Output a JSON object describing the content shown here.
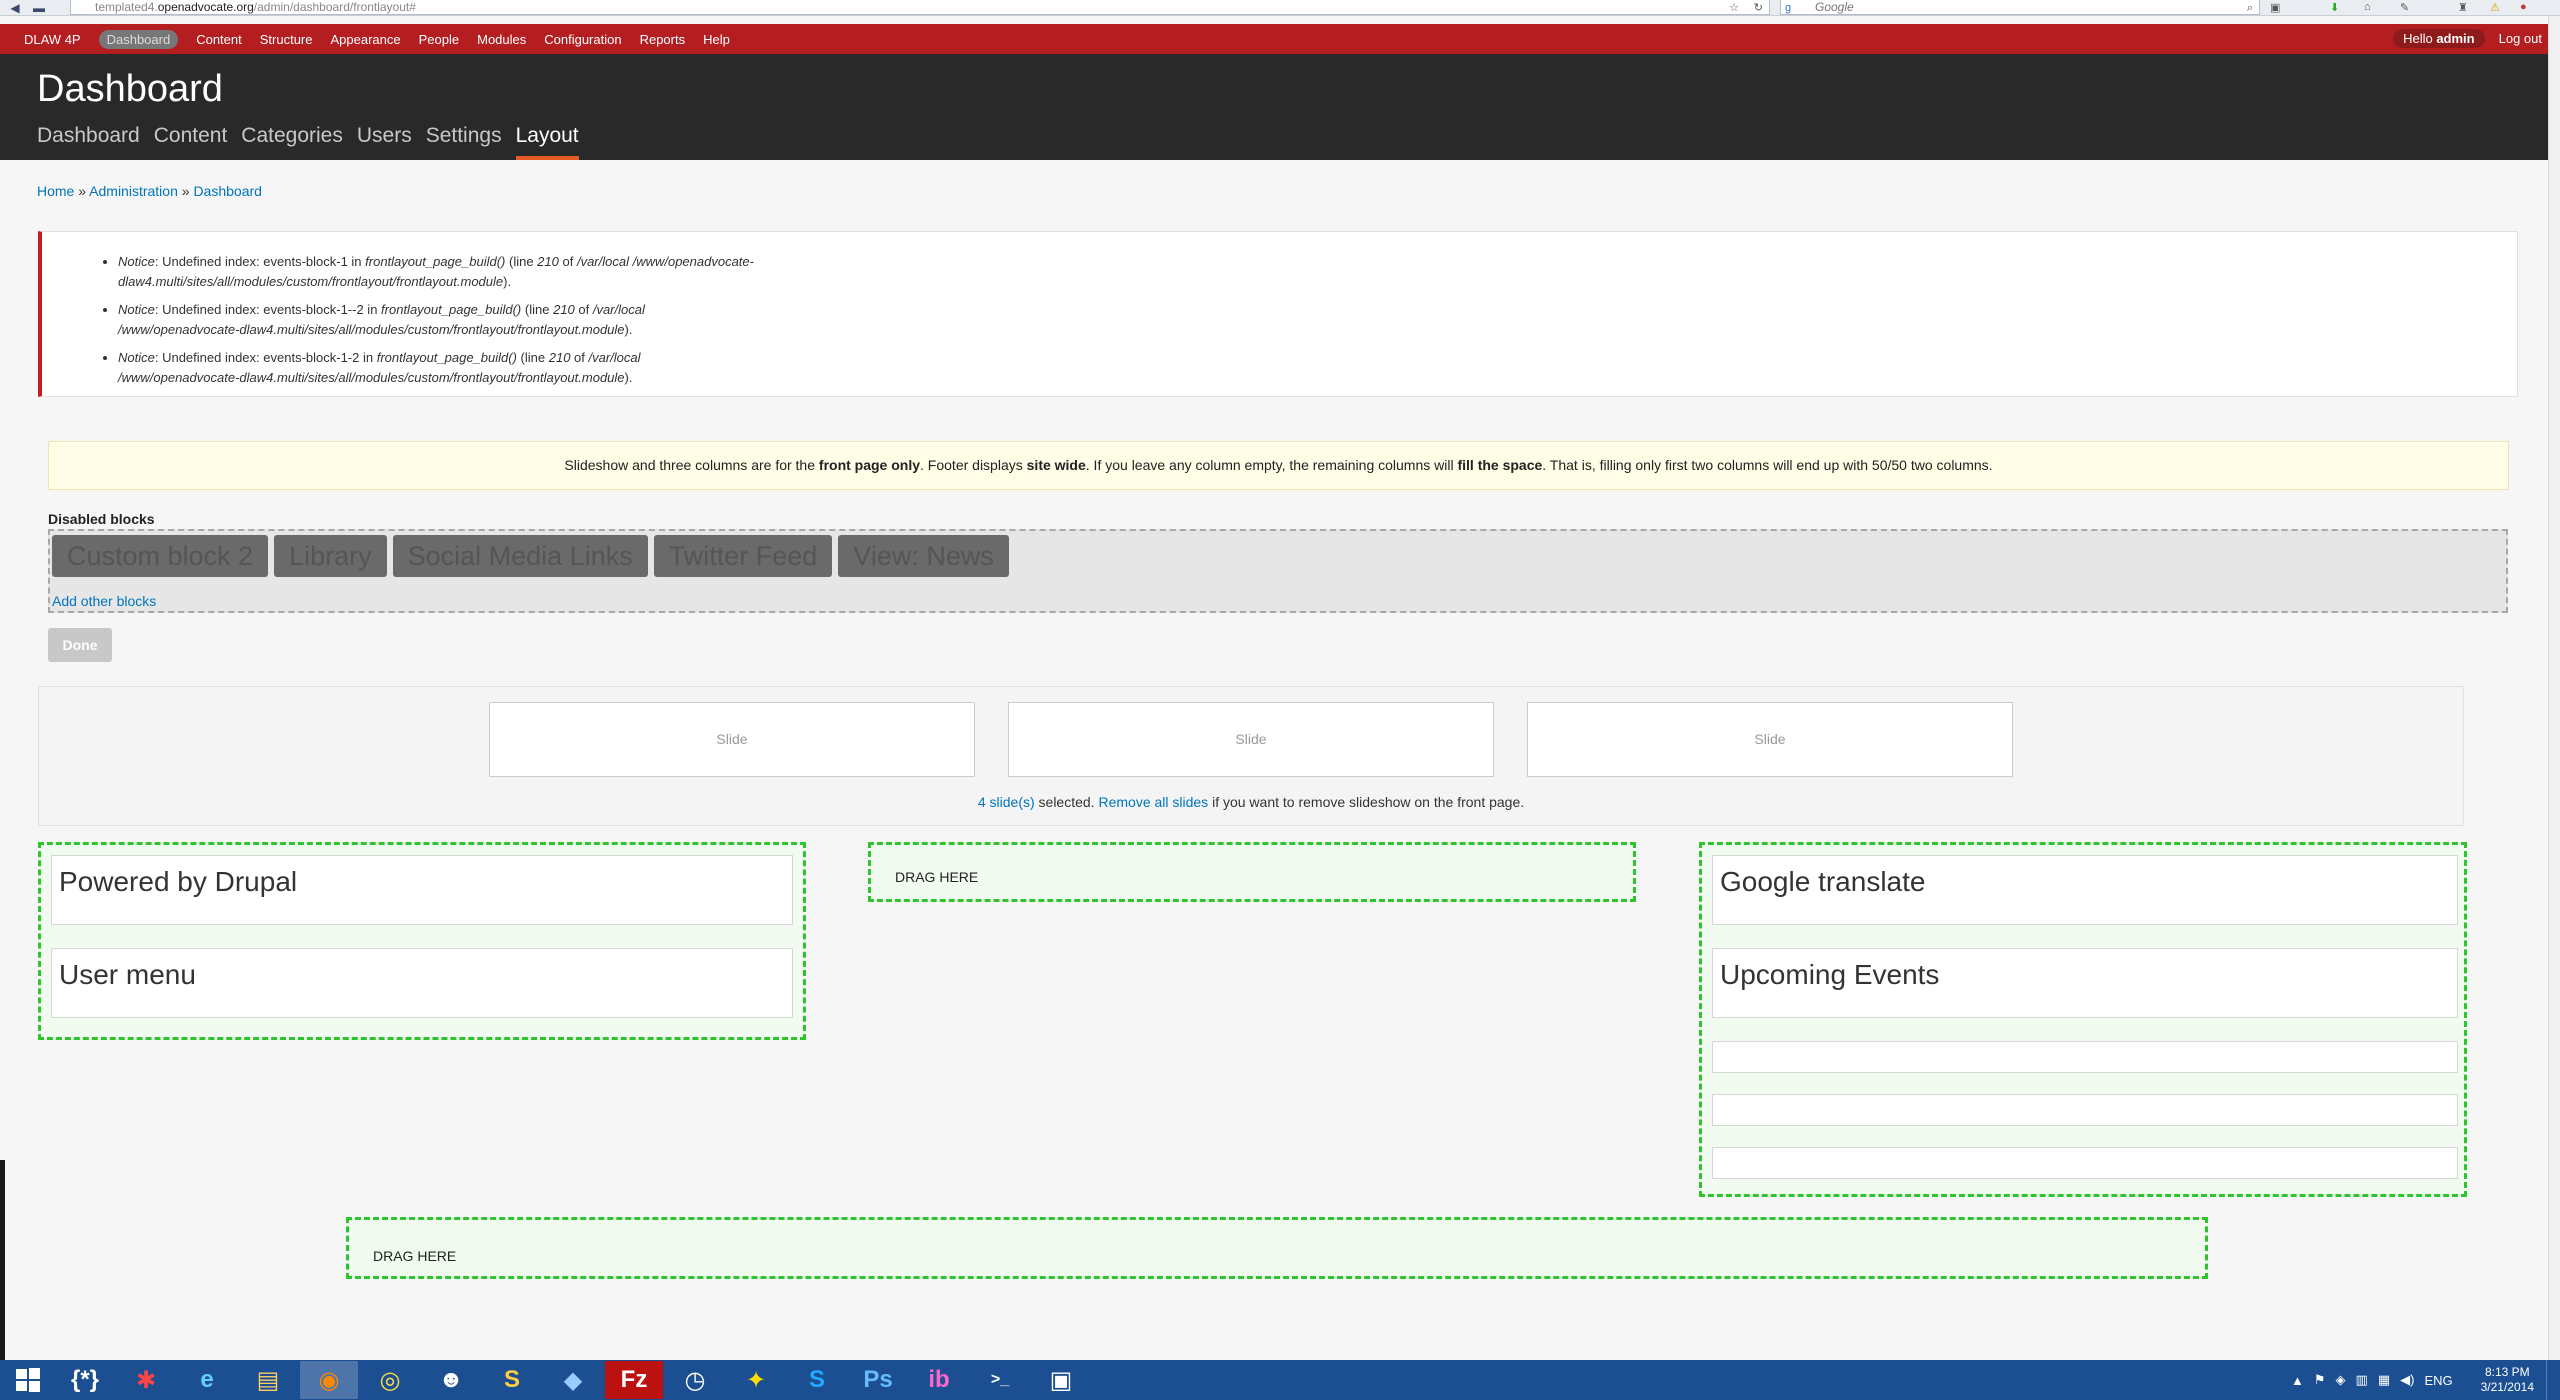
{
  "browser": {
    "url_prefix": "templated4.",
    "url_domain": "openadvocate.org",
    "url_path": "/admin/dashboard/frontlayout#",
    "search_placeholder": "Google"
  },
  "toolbar": {
    "items": [
      "DLAW 4P",
      "Dashboard",
      "Content",
      "Structure",
      "Appearance",
      "People",
      "Modules",
      "Configuration",
      "Reports",
      "Help"
    ],
    "hello_prefix": "Hello ",
    "hello_user": "admin",
    "logout": "Log out"
  },
  "header": {
    "title": "Dashboard",
    "tabs": [
      "Dashboard",
      "Content",
      "Categories",
      "Users",
      "Settings",
      "Layout"
    ]
  },
  "breadcrumb": {
    "home": "Home",
    "sep1": " » ",
    "admin": "Administration",
    "sep2": " » ",
    "dashboard": "Dashboard"
  },
  "messages": [
    {
      "label": "Notice",
      "text1": ": Undefined index: events-block-1 in ",
      "func": "frontlayout_page_build()",
      "text2": " (line ",
      "line": "210",
      "text3": " of ",
      "path": "/var/local /www/openadvocate-dlaw4.multi/sites/all/modules/custom/frontlayout/frontlayout.module",
      "end": ")."
    },
    {
      "label": "Notice",
      "text1": ": Undefined index: events-block-1--2 in ",
      "func": "frontlayout_page_build()",
      "text2": " (line ",
      "line": "210",
      "text3": " of ",
      "path": "/var/local /www/openadvocate-dlaw4.multi/sites/all/modules/custom/frontlayout/frontlayout.module",
      "end": ")."
    },
    {
      "label": "Notice",
      "text1": ": Undefined index: events-block-1-2 in ",
      "func": "frontlayout_page_build()",
      "text2": " (line ",
      "line": "210",
      "text3": " of ",
      "path": "/var/local /www/openadvocate-dlaw4.multi/sites/all/modules/custom/frontlayout/frontlayout.module",
      "end": ")."
    }
  ],
  "info": {
    "t1": "Slideshow and three columns are for the ",
    "b1": "front page only",
    "t2": ". Footer displays ",
    "b2": "site wide",
    "t3": ". If you leave any column empty, the remaining columns will ",
    "b3": "fill the space",
    "t4": ". That is, filling only first two columns will end up with 50/50 two columns."
  },
  "disabled": {
    "label": "Disabled blocks",
    "blocks": [
      "Custom block 2",
      "Library",
      "Social Media Links",
      "Twitter Feed",
      "View: News"
    ],
    "add_link": "Add other blocks"
  },
  "done_button": "Done",
  "slideshow": {
    "slides": [
      "Slide",
      "Slide",
      "Slide"
    ],
    "count_link": "4 slide(s)",
    "t1": " selected. ",
    "remove_link": "Remove all slides",
    "t2": " if you want to remove slideshow on the front page."
  },
  "regions": {
    "left_blocks": [
      "Powered by Drupal",
      "User menu"
    ],
    "middle_drag": "DRAG HERE",
    "right_blocks": [
      "Google translate",
      "Upcoming Events"
    ],
    "footer_drag": "DRAG HERE"
  },
  "taskbar": {
    "apps": [
      "{*}",
      "✱",
      "e",
      "▤",
      "◉",
      "◎",
      "☻",
      "S",
      "◆",
      "Fz",
      "◷",
      "✦",
      "S",
      "Ps",
      "ib",
      ">_",
      "▣"
    ],
    "lang": "ENG",
    "time": "8:13 PM",
    "date": "3/21/2014"
  },
  "colors": {
    "toolbar_red": "#b41e21",
    "header_dark": "#292929",
    "tab_active_underline": "#e45b26",
    "link_blue": "#0074bd",
    "region_dashed_green": "#2ec42e",
    "taskbar_blue": "#1c4f91"
  }
}
